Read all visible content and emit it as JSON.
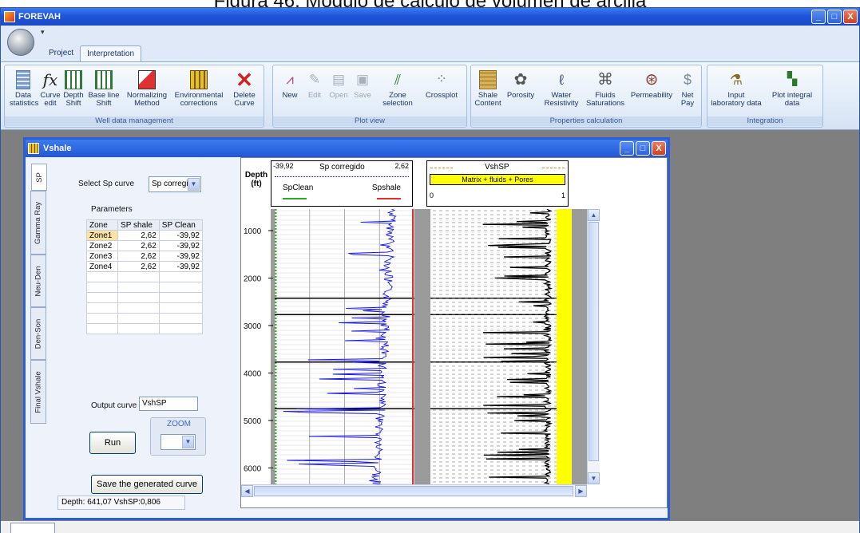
{
  "caption": "Figura 46. Módulo de cálculo de volumen de arcilla",
  "app": {
    "title": "FOREVAH"
  },
  "window_controls": {
    "minimize": "_",
    "maximize": "□",
    "close": "X"
  },
  "ribbon": {
    "tabs": [
      {
        "label": "Project"
      },
      {
        "label": "Interpretation",
        "active": true
      }
    ],
    "groups": [
      {
        "label": "Well data management",
        "buttons": [
          {
            "label": "Data statistics",
            "icon": "data-statistics-icon"
          },
          {
            "label": "Curve edit",
            "icon": "fx-icon"
          },
          {
            "label": "Depth Shift",
            "icon": "depth-shift-icon"
          },
          {
            "label": "Base line Shift",
            "icon": "base-line-shift-icon"
          },
          {
            "label": "Normalizing Method",
            "icon": "normalizing-icon"
          },
          {
            "label": "Environmental corrections",
            "icon": "environmental-icon"
          },
          {
            "label": "Delete Curve",
            "icon": "delete-x-icon"
          }
        ]
      },
      {
        "label": "Plot view",
        "buttons": [
          {
            "label": "New",
            "icon": "new-plot-icon"
          },
          {
            "label": "Edit",
            "icon": "edit-icon",
            "disabled": true
          },
          {
            "label": "Open",
            "icon": "open-icon",
            "disabled": true
          },
          {
            "label": "Save",
            "icon": "save-icon",
            "disabled": true
          },
          {
            "label": "Zone selection",
            "icon": "zone-selection-icon"
          },
          {
            "label": "Crossplot",
            "icon": "crossplot-icon"
          }
        ]
      },
      {
        "label": "Properties calculation",
        "buttons": [
          {
            "label": "Shale Content",
            "icon": "shale-content-icon"
          },
          {
            "label": "Porosity",
            "icon": "porosity-icon"
          },
          {
            "label": "Water Resistivity",
            "icon": "water-resistivity-icon"
          },
          {
            "label": "Fluids Saturations",
            "icon": "fluids-icon"
          },
          {
            "label": "Permeability",
            "icon": "permeability-icon"
          },
          {
            "label": "Net Pay",
            "icon": "net-pay-icon"
          }
        ]
      },
      {
        "label": "Integration",
        "buttons": [
          {
            "label": "Input laboratory data",
            "icon": "input-lab-icon"
          },
          {
            "label": "Plot integral data",
            "icon": "plot-integral-icon"
          }
        ]
      }
    ]
  },
  "vshale": {
    "title": "Vshale",
    "side_tabs": [
      "SP",
      "Gamma Ray",
      "Neu-Den",
      "Den-Son",
      "Final Vshale"
    ],
    "active_tab": "SP",
    "select_sp_label": "Select Sp curve",
    "select_sp_value": "Sp corregid",
    "parameters_label": "Parameters",
    "table": {
      "headers": [
        "Zone",
        "SP shale",
        "SP Clean"
      ],
      "rows": [
        [
          "Zone1",
          "2,62",
          "-39,92"
        ],
        [
          "Zone2",
          "2,62",
          "-39,92"
        ],
        [
          "Zone3",
          "2,62",
          "-39,92"
        ],
        [
          "Zone4",
          "2,62",
          "-39,92"
        ]
      ]
    },
    "output_label": "Output curve",
    "output_value": "VshSP",
    "run_label": "Run",
    "zoom_label": "ZOOM",
    "zoom_value": "",
    "save_label": "Save the generated curve",
    "depth_readout": "Depth: 641,07 VshSP:0,806"
  },
  "log_plot": {
    "depth_header": {
      "line1": "Depth",
      "line2": "(ft)"
    },
    "track1": {
      "left_value": "-39,92",
      "curve_name": "Sp corregido",
      "right_value": "2,62",
      "left_line": "SpClean",
      "right_line": "Spshale",
      "left_color": "#2aa82a",
      "right_color": "#e03030",
      "curve_color": "#1515e0"
    },
    "track2": {
      "curve_name": "VshSP",
      "legend_text": "Matrix + fluids + Pores",
      "scale_min": "0",
      "scale_max": "1",
      "fill_color": "#ffff00"
    },
    "depth_ticks": [
      "1000",
      "2000",
      "3000",
      "4000",
      "5000",
      "6000"
    ]
  }
}
